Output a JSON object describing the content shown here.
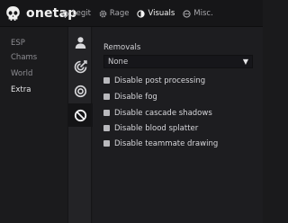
{
  "app": {
    "name": "onetap",
    "logo": "skull-logo"
  },
  "nav": [
    {
      "label": "Legit",
      "icon": "crosshair-icon",
      "active": false
    },
    {
      "label": "Rage",
      "icon": "gear-icon",
      "active": false
    },
    {
      "label": "Visuals",
      "icon": "half-circle-icon",
      "active": true
    },
    {
      "label": "Misc.",
      "icon": "dots-icon",
      "active": false
    }
  ],
  "sidebar": {
    "items": [
      {
        "label": "ESP",
        "active": false
      },
      {
        "label": "Chams",
        "active": false
      },
      {
        "label": "World",
        "active": false
      },
      {
        "label": "Extra",
        "active": true
      }
    ]
  },
  "rail": {
    "items": [
      {
        "icon": "user-icon",
        "active": false
      },
      {
        "icon": "target-icon",
        "active": false
      },
      {
        "icon": "circle-target-icon",
        "active": false
      },
      {
        "icon": "block-icon",
        "active": true
      }
    ]
  },
  "removals": {
    "label": "Removals",
    "dropdown_value": "None",
    "caret": "▼",
    "options": [
      {
        "label": "Disable post processing",
        "checked": false
      },
      {
        "label": "Disable fog",
        "checked": false
      },
      {
        "label": "Disable cascade shadows",
        "checked": false
      },
      {
        "label": "Disable blood splatter",
        "checked": false
      },
      {
        "label": "Disable teammate drawing",
        "checked": false
      }
    ]
  },
  "colors": {
    "accent": "#e6e6e8",
    "background": "#1b1b1d",
    "checkbox": "#b9b9bd"
  }
}
